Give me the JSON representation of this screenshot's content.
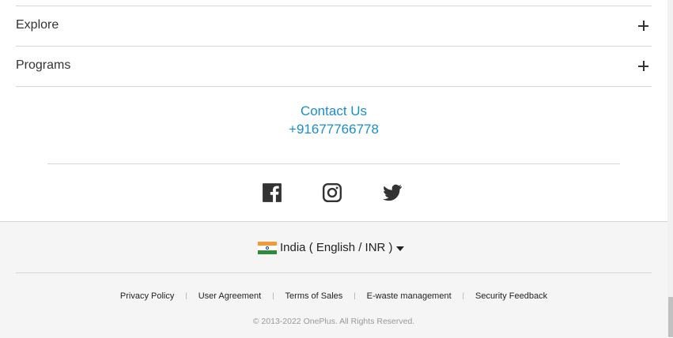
{
  "accordion": [
    {
      "label": "Explore"
    },
    {
      "label": "Programs"
    }
  ],
  "contact": {
    "title": "Contact Us",
    "phone": "+91677766778"
  },
  "social": [
    {
      "icon": "facebook-icon"
    },
    {
      "icon": "instagram-icon"
    },
    {
      "icon": "twitter-icon"
    }
  ],
  "region": {
    "text": "India ( English / INR )",
    "flag_icon": "india-flag-icon"
  },
  "links": [
    {
      "label": "Privacy Policy"
    },
    {
      "label": "User Agreement"
    },
    {
      "label": "Terms of Sales"
    },
    {
      "label": "E-waste management"
    },
    {
      "label": "Security Feedback"
    }
  ],
  "copyright": "© 2013-2022 OnePlus. All Rights Reserved.",
  "colors": {
    "link_blue": "#1a8ec8",
    "footer_bg": "#f5f5f5",
    "divider": "#d6d6d6"
  }
}
